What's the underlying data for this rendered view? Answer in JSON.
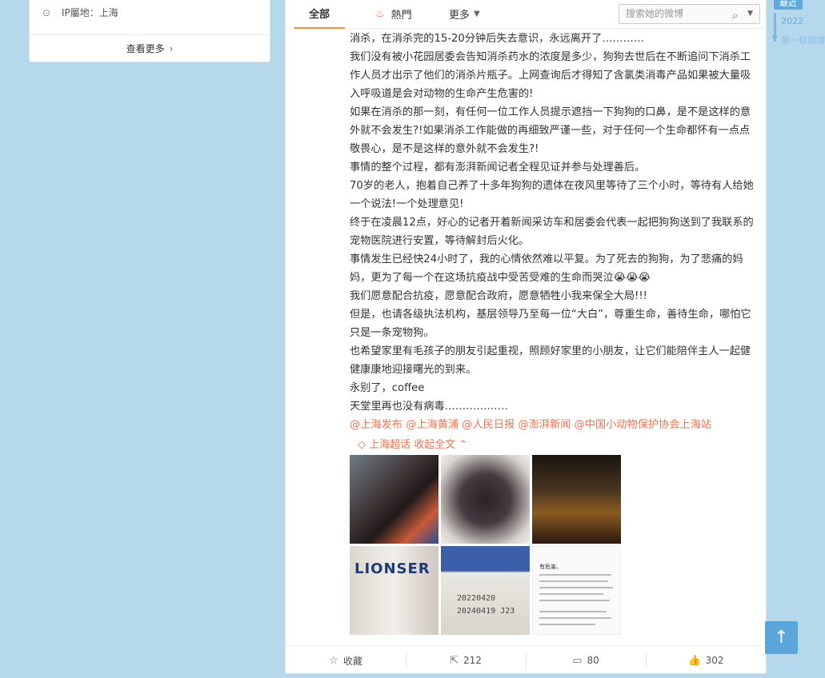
{
  "left_card": {
    "ip_label": "IP屬地：上海",
    "more": "查看更多"
  },
  "tabs": {
    "all": "全部",
    "hot": "熱門",
    "more": "更多",
    "search_placeholder": "搜索她的微博"
  },
  "post": {
    "lines": [
      "消杀，在消杀完的15-20分钟后失去意识，永远离开了…………",
      "我们没有被小花园居委会告知消杀药水的浓度是多少，狗狗去世后在不断追问下消杀工作人员才出示了他们的消杀片瓶子。上网查询后才得知了含氯类消毒产品如果被大量吸入呼吸道是会对动物的生命产生危害的!",
      "如果在消杀的那一刻，有任何一位工作人员提示遮挡一下狗狗的口鼻，是不是这样的意外就不会发生?!如果消杀工作能做的再细致严谨一些，对于任何一个生命都怀有一点点敬畏心，是不是这样的意外就不会发生?!",
      "事情的整个过程，都有澎湃新闻记者全程见证并参与处理善后。",
      "70岁的老人，抱着自己养了十多年狗狗的遗体在夜风里等待了三个小时，等待有人给她一个说法!一个处理意见!",
      "终于在凌晨12点，好心的记者开着新闻采访车和居委会代表一起把狗狗送到了我联系的宠物医院进行安置，等待解封后火化。",
      "事情发生已经快24小时了，我的心情依然难以平复。为了死去的狗狗，为了悲痛的妈妈，更为了每一个在这场抗疫战中受苦受难的生命而哭泣😭😭😭",
      "我们愿意配合抗疫，愿意配合政府，愿意牺牲小我来保全大局!!!",
      "但是，也请各级执法机构，基层领导乃至每一位“大白”，尊重生命，善待生命，哪怕它只是一条宠物狗。",
      "也希望家里有毛孩子的朋友引起重视，照顾好家里的小朋友，让它们能陪伴主人一起健健康康地迎接曙光的到来。",
      "永别了，coffee",
      "天堂里再也没有病毒………………"
    ],
    "mentions": "@上海发布 @上海黄浦 @人民日报 @澎湃新闻 @中国小动物保护协会上海站",
    "chaohua": "上海超话",
    "collapse": "收起全文",
    "photo_text": {
      "brand": "LIONSER",
      "date1": "20220420",
      "date2": "20240419 J23",
      "doc_title": "有危害。"
    }
  },
  "actions": {
    "collect": "收藏",
    "repost": "212",
    "comment": "80",
    "like": "302"
  },
  "timeline": {
    "recent": "最近",
    "year": "2022",
    "first": "第一條微博"
  },
  "colors": {
    "accent": "#eb7350",
    "background": "#b5d8ec",
    "timeline": "#64a9dd"
  }
}
